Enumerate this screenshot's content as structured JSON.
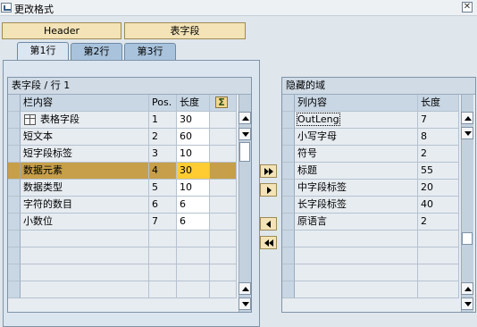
{
  "window": {
    "title": "更改格式",
    "close_glyph": "✕"
  },
  "header_buttons": [
    "Header",
    "表字段"
  ],
  "tabs": [
    "第1行",
    "第2行",
    "第3行"
  ],
  "left_table": {
    "title": "表字段 / 行 1",
    "columns": [
      "栏内容",
      "Pos.",
      "长度"
    ],
    "rows": [
      {
        "content": "表格字段",
        "pos": "1",
        "length": "30",
        "icon": "table-icon"
      },
      {
        "content": "短文本",
        "pos": "2",
        "length": "60"
      },
      {
        "content": "短字段标签",
        "pos": "3",
        "length": "10"
      },
      {
        "content": "数据元素",
        "pos": "4",
        "length": "30",
        "selected": true
      },
      {
        "content": "数据类型",
        "pos": "5",
        "length": "10"
      },
      {
        "content": "字符的数目",
        "pos": "6",
        "length": "6"
      },
      {
        "content": "小数位",
        "pos": "7",
        "length": "6"
      }
    ]
  },
  "right_table": {
    "title": "隐藏的域",
    "columns": [
      "列内容",
      "长度"
    ],
    "rows": [
      {
        "content": "OutLeng",
        "length": "7"
      },
      {
        "content": "小写字母",
        "length": "8"
      },
      {
        "content": "符号",
        "length": "2"
      },
      {
        "content": "标题",
        "length": "55"
      },
      {
        "content": "中字段标签",
        "length": "20"
      },
      {
        "content": "长字段标签",
        "length": "40"
      },
      {
        "content": "原语言",
        "length": "2"
      }
    ]
  },
  "icons": {
    "sum": "sum-icon",
    "move_all_right": "double-right-icon",
    "move_right": "right-arrow-icon",
    "move_left": "left-arrow-icon",
    "move_all_left": "double-left-icon"
  },
  "colors": {
    "header_button": "#f3e3b6",
    "tab_active": "#dbe6f1",
    "tab_inactive": "#a9c3dc",
    "selected_row": "#c79f4a",
    "selected_cell": "#ffcc33"
  }
}
